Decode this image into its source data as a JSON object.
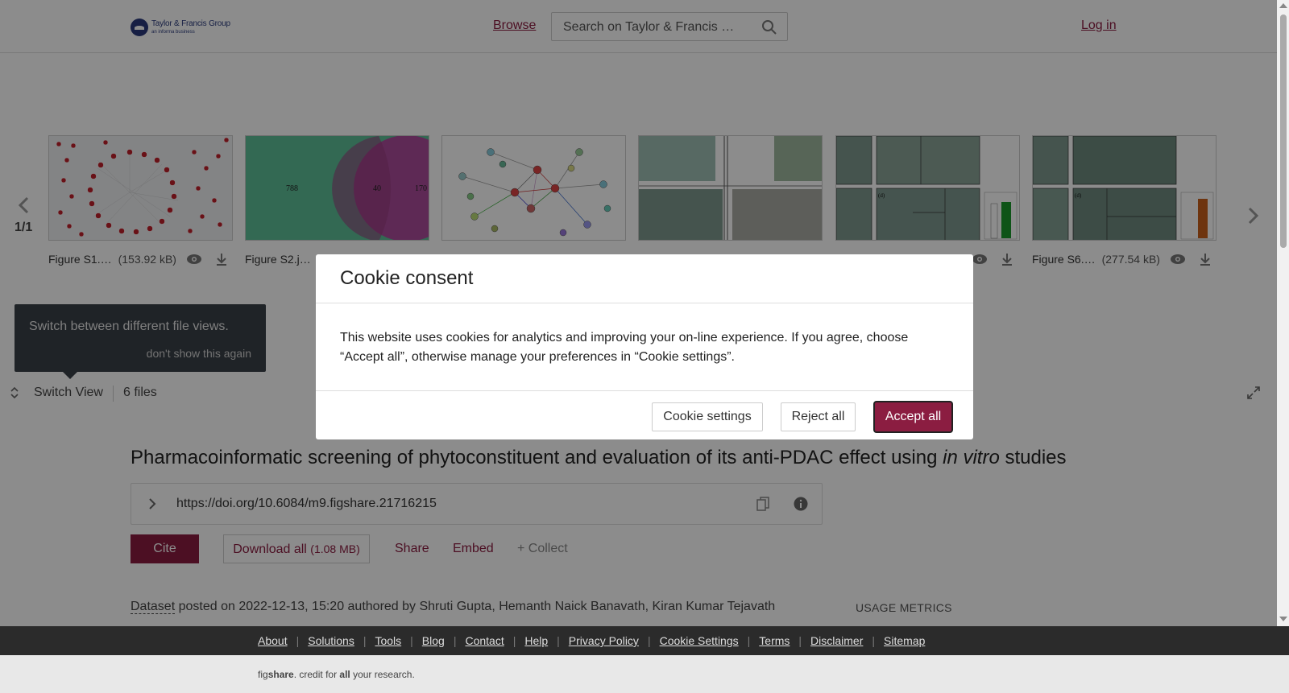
{
  "header": {
    "logo_main": "Taylor & Francis Group",
    "logo_sub": "an informa business",
    "browse_label": "Browse",
    "search_placeholder": "Search on Taylor & Francis …",
    "login_label": "Log in"
  },
  "viewer": {
    "page_count": "1/1",
    "files": [
      {
        "name": "Figure S1.…",
        "size": "(153.92 kB)"
      },
      {
        "name": "Figure S2.j…",
        "size": ""
      },
      {
        "name": "",
        "size": ""
      },
      {
        "name": "",
        "size": ""
      },
      {
        "name": "",
        "size": ""
      },
      {
        "name": "Figure S6.…",
        "size": "(277.54 kB)"
      }
    ],
    "venn_values": [
      "788",
      "40",
      "170"
    ],
    "tooltip_text": "Switch between different file views.",
    "tooltip_dismiss": "don't show this again",
    "switch_view_label": "Switch View",
    "files_count": "6 files"
  },
  "article": {
    "title_prefix": "Pharmacoinformatic screening of phytoconstituent and evaluation of its anti-PDAC effect using ",
    "title_italic": "in vitro",
    "title_suffix": " studies",
    "doi": "https://doi.org/10.6084/m9.figshare.21716215",
    "cite_label": "Cite",
    "download_all_label": "Download all",
    "download_all_size": "(1.08 MB)",
    "share_label": "Share",
    "embed_label": "Embed",
    "collect_label": "+ Collect",
    "item_type": "Dataset",
    "posted_text": " posted on 2022-12-13, 15:20 authored by Shruti Gupta, Hemanth Naick Banavath, Kiran Kumar Tejavath",
    "usage_metrics_label": "USAGE METRICS"
  },
  "footer": {
    "links": [
      "About",
      "Solutions",
      "Tools",
      "Blog",
      "Contact",
      "Help",
      "Privacy Policy",
      "Cookie Settings",
      "Terms",
      "Disclaimer",
      "Sitemap"
    ],
    "credit_fig": "fig",
    "credit_share": "share",
    "credit_mid": ". credit for ",
    "credit_all": "all",
    "credit_end": " your research."
  },
  "cookie_modal": {
    "title": "Cookie consent",
    "body": "This website uses cookies for analytics and improving your on-line experience. If you agree, choose “Accept all”, otherwise manage your preferences in “Cookie settings”.",
    "settings_label": "Cookie settings",
    "reject_label": "Reject all",
    "accept_label": "Accept all"
  },
  "colors": {
    "brand": "#8b1d41",
    "overlay": "rgba(0,0,0,0.45)",
    "footer_dark": "#2b2b2b"
  }
}
